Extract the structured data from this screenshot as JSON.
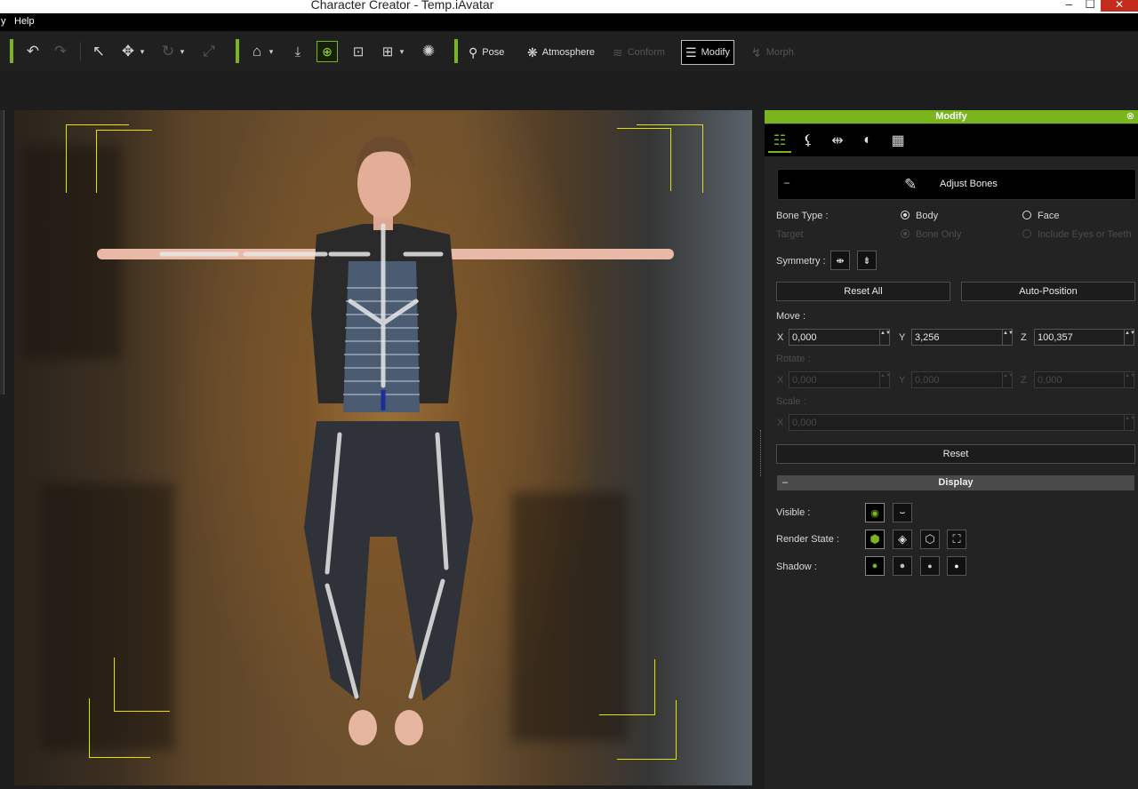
{
  "window": {
    "title": "Character Creator - Temp.iAvatar",
    "minimize": "–",
    "maximize": "☐",
    "close": "✕"
  },
  "menu": {
    "partial_item": "y",
    "help": "Help"
  },
  "toolbar": {
    "undo_icon": "↶",
    "redo_icon": "↷",
    "select_icon": "↖",
    "move_icon": "✥",
    "rotate_icon": "↻",
    "scale_icon": "⤢",
    "home_icon": "⌂",
    "fit_down_icon": "⤓",
    "frame_icon": "⊕",
    "frame2_icon": "⊡",
    "frame3_icon": "⊞",
    "light_icon": "✺",
    "pose": "Pose",
    "pose_icon": "⚲",
    "atmosphere": "Atmosphere",
    "atmosphere_icon": "❋",
    "conform": "Conform",
    "conform_icon": "≋",
    "modify": "Modify",
    "modify_icon": "☰",
    "morph": "Morph",
    "morph_icon": "↯",
    "dropdown_arrow": "▾"
  },
  "panel": {
    "header": "Modify",
    "close_icon": "⊗",
    "tabs": {
      "modify_icon": "☷",
      "pose_icon": "⚸",
      "fit_icon": "⇹",
      "material_icon": "◐",
      "texture_icon": "▦"
    },
    "adjust_bones": {
      "collapse": "–",
      "icon": "✎",
      "label": "Adjust Bones"
    },
    "bone_type_label": "Bone Type :",
    "body": "Body",
    "face": "Face",
    "target_label": "Target",
    "bone_only": "Bone Only",
    "include_eyes": "Include Eyes or Teeth",
    "symmetry_label": "Symmetry :",
    "sym_icon_1": "⇼",
    "sym_icon_2": "⇟",
    "reset_all": "Reset All",
    "auto_position": "Auto-Position",
    "move_label": "Move :",
    "move": {
      "x_label": "X",
      "x": "0,000",
      "y_label": "Y",
      "y": "3,256",
      "z_label": "Z",
      "z": "100,357"
    },
    "rotate_label": "Rotate :",
    "rotate": {
      "x_label": "X",
      "x": "0,000",
      "y_label": "Y",
      "y": "0,000",
      "z_label": "Z",
      "z": "0,000"
    },
    "scale_label": "Scale :",
    "scale": {
      "x_label": "X",
      "x": "0,000"
    },
    "spin_arrows": "▲▼",
    "reset": "Reset",
    "display": {
      "collapse": "–",
      "label": "Display"
    },
    "visible_label": "Visible :",
    "render_state_label": "Render State :",
    "shadow_label": "Shadow :",
    "icons": {
      "eye": "◉",
      "eye_closed": "⌣",
      "rs_solid": "⬢",
      "rs_shaded": "◈",
      "rs_wire": "⬡",
      "rs_bbox": "⛶",
      "sh_1": "●",
      "sh_2": "●",
      "sh_3": "●",
      "sh_4": "●"
    }
  },
  "colors": {
    "accent": "#7ab51d",
    "selection": "#e8e000",
    "panel_bg": "#232323"
  }
}
